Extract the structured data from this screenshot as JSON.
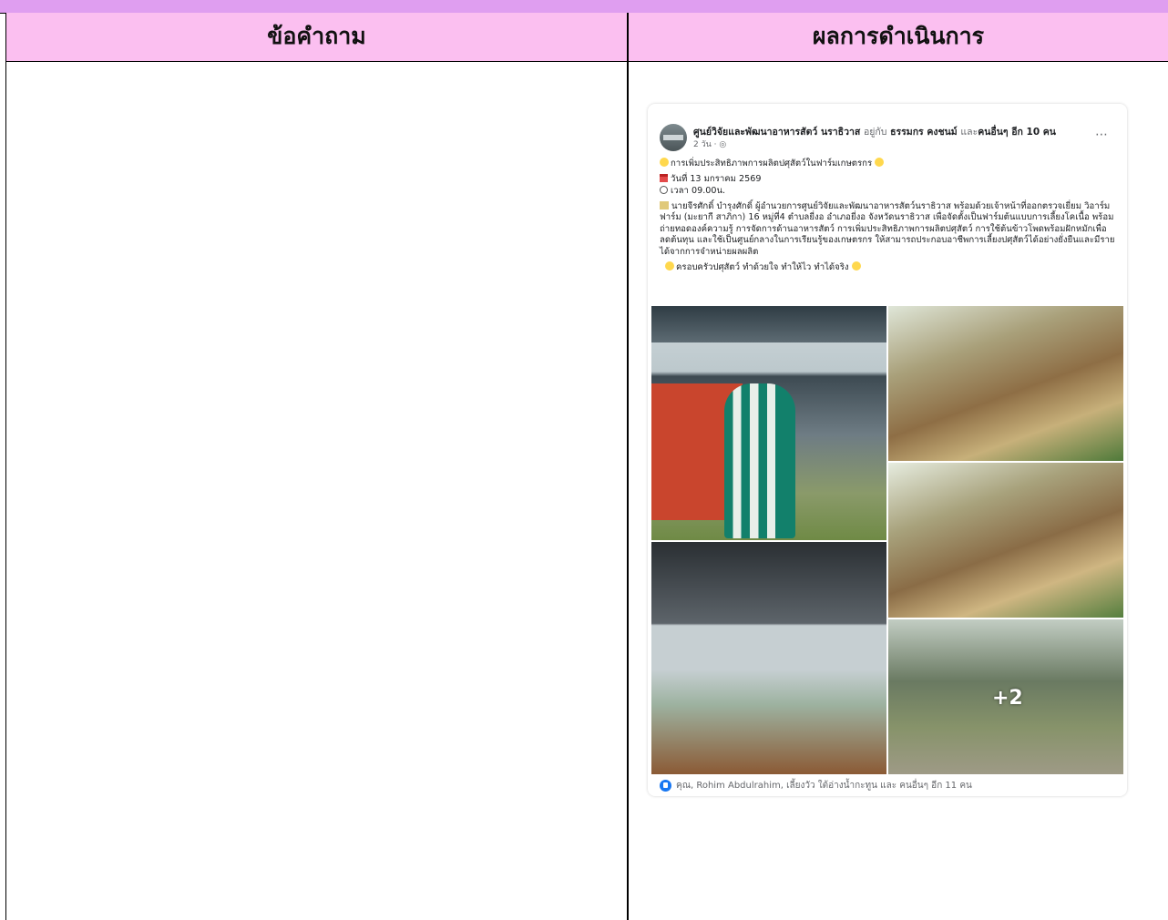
{
  "table": {
    "header_left": "ข้อคำถาม",
    "header_right": "ผลการดำเนินการ"
  },
  "post": {
    "page_name": "ศูนย์วิจัยและพัฒนาอาหารสัตว์ นราธิวาส",
    "with_text": "อยู่กับ",
    "tagged_person": "ธรรมกร คงชนม์",
    "and_others_text": "และ",
    "others": "คนอื่นๆ อีก 10 คน",
    "time": "2 วัน · ",
    "title_line": "การเพิ่มประสิทธิภาพการผลิตปศุสัตว์ในฟาร์มเกษตรกร",
    "date_line": "วันที่ 13 มกราคม 2569",
    "time_line": "เวลา 09.00น.",
    "body": "นายจีรศักดิ์ บำรุงศักดิ์ ผู้อำนวยการศูนย์วิจัยและพัฒนาอาหารสัตว์นราธิวาส พร้อมด้วยเจ้าหน้าที่ออกตรวจเยี่ยม วิอาร์มฟาร์ม (มะยากี สาภิกา) 16 หมู่ที่4 ตำบลยี่งอ อำเภอยี่งอ จังหวัดนราธิวาส เพื่อจัดตั้งเป็นฟาร์มต้นแบบการเลี้ยงโคเนื้อ พร้อมถ่ายทอดองค์ความรู้ การจัดการด้านอาหารสัตว์ การเพิ่มประสิทธิภาพการผลิตปศุสัตว์ การใช้ต้นข้าวโพดพร้อมฝักหมักเพื่อลดต้นทุน และใช้เป็นศูนย์กลางในการเรียนรู้ของเกษตรกร ให้สามารถประกอบอาชีพการเลี้ยงปศุสัตว์ได้อย่างยั่งยืนและมีรายได้จากการจำหน่ายผลผลิต",
    "slogan": "ครอบครัวปศุสัตว์ ทำด้วยใจ ทำให้ไว ทำได้จริง",
    "more_photos": "+2",
    "reactions": "คุณ, Rohim Abdulrahim, เลี้ยงวัว ใต้อ่างน้ำกะทูน และ คนอื่นๆ อีก 11 คน",
    "more_icon": "⋯"
  }
}
